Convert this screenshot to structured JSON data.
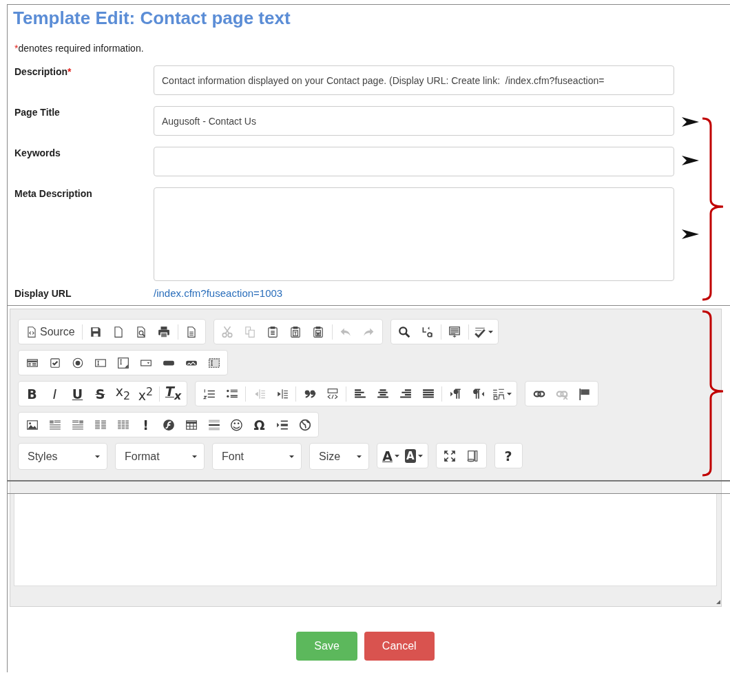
{
  "title": "Template Edit: Contact page text",
  "form": {
    "required_note": {
      "mark": "*",
      "text": "denotes required information."
    },
    "fields": [
      {
        "label": "Description",
        "required_mark": "*",
        "kind": "input",
        "value": "Contact information displayed on your Contact page. (Display URL: Create link:  /index.cfm?fuseaction="
      },
      {
        "label": "Page Title",
        "kind": "input",
        "value": "Augusoft - Contact Us"
      },
      {
        "label": "Keywords",
        "kind": "input"
      },
      {
        "label": "Meta Description",
        "kind": "textarea"
      }
    ],
    "display_url": {
      "label": "Display URL",
      "link": "/index.cfm?fuseaction=1003"
    }
  },
  "editor": {
    "toolbar": {
      "rows": [
        {
          "groups": [
            {
              "items": [
                {
                  "kind": "label-button",
                  "label": "Source",
                  "disabled": false
                },
                {
                  "kind": "separator"
                },
                {
                  "kind": "icon-button",
                  "disabled": false
                },
                {
                  "kind": "icon-button",
                  "disabled": false
                },
                {
                  "kind": "icon-button",
                  "disabled": false
                },
                {
                  "kind": "icon-button",
                  "disabled": false
                },
                {
                  "kind": "separator"
                },
                {
                  "kind": "icon-button",
                  "disabled": false
                }
              ]
            },
            {
              "items": [
                {
                  "kind": "icon-button",
                  "disabled": true
                },
                {
                  "kind": "icon-button",
                  "disabled": true
                },
                {
                  "kind": "icon-button",
                  "disabled": false
                },
                {
                  "kind": "icon-button",
                  "disabled": false
                },
                {
                  "kind": "icon-button",
                  "disabled": false
                },
                {
                  "kind": "separator"
                },
                {
                  "kind": "icon-button",
                  "disabled": true
                },
                {
                  "kind": "icon-button",
                  "disabled": true
                }
              ]
            },
            {
              "items": [
                {
                  "kind": "icon-button",
                  "disabled": false
                },
                {
                  "kind": "icon-button",
                  "disabled": false
                },
                {
                  "kind": "separator"
                },
                {
                  "kind": "icon-button",
                  "disabled": false
                },
                {
                  "kind": "separator"
                },
                {
                  "kind": "menu-button",
                  "disabled": false
                }
              ]
            }
          ]
        },
        {
          "groups": [
            {
              "items": [
                {
                  "kind": "icon-button",
                  "disabled": false
                },
                {
                  "kind": "icon-button",
                  "disabled": false
                },
                {
                  "kind": "icon-button",
                  "disabled": false
                },
                {
                  "kind": "icon-button",
                  "disabled": false
                },
                {
                  "kind": "icon-button",
                  "disabled": false
                },
                {
                  "kind": "icon-button",
                  "disabled": false
                },
                {
                  "kind": "icon-button",
                  "disabled": false
                },
                {
                  "kind": "icon-button",
                  "disabled": false
                },
                {
                  "kind": "icon-button",
                  "disabled": false
                }
              ]
            }
          ]
        },
        {
          "groups": [
            {
              "items": [
                {
                  "kind": "bold",
                  "label": "B",
                  "disabled": false
                },
                {
                  "kind": "italic",
                  "label": "I",
                  "disabled": false
                },
                {
                  "kind": "underline",
                  "label": "U",
                  "disabled": false
                },
                {
                  "kind": "strike",
                  "label": "S",
                  "disabled": false
                },
                {
                  "kind": "symbol",
                  "label": "x$_{2}$",
                  "disabled": false
                },
                {
                  "kind": "symbol",
                  "label": "x$^{2}$",
                  "disabled": false
                },
                {
                  "kind": "separator"
                },
                {
                  "kind": "clearformat",
                  "label": "T$_{x}$",
                  "disabled": false
                }
              ]
            },
            {
              "items": [
                {
                  "kind": "icon-button",
                  "disabled": false
                },
                {
                  "kind": "icon-button",
                  "disabled": false
                },
                {
                  "kind": "separator"
                },
                {
                  "kind": "icon-button",
                  "disabled": true
                },
                {
                  "kind": "icon-button",
                  "disabled": false
                },
                {
                  "kind": "separator"
                },
                {
                  "kind": "icon-button",
                  "disabled": false
                },
                {
                  "kind": "icon-button",
                  "disabled": false
                },
                {
                  "kind": "separator"
                },
                {
                  "kind": "icon-button",
                  "disabled": false
                },
                {
                  "kind": "icon-button",
                  "disabled": false
                },
                {
                  "kind": "icon-button",
                  "disabled": false
                },
                {
                  "kind": "icon-button",
                  "disabled": false
                },
                {
                  "kind": "separator"
                },
                {
                  "kind": "icon-button",
                  "disabled": false
                },
                {
                  "kind": "icon-button",
                  "disabled": false
                },
                {
                  "kind": "menu-button",
                  "disabled": false
                }
              ]
            },
            {
              "items": [
                {
                  "kind": "icon-button",
                  "disabled": false
                },
                {
                  "kind": "icon-button",
                  "disabled": true
                },
                {
                  "kind": "icon-button",
                  "disabled": false
                }
              ]
            }
          ]
        },
        {
          "groups": [
            {
              "items": [
                {
                  "kind": "icon-button",
                  "disabled": false
                },
                {
                  "kind": "icon-button",
                  "disabled": false
                },
                {
                  "kind": "icon-button",
                  "disabled": false
                },
                {
                  "kind": "icon-button",
                  "disabled": false
                },
                {
                  "kind": "icon-button",
                  "disabled": false
                },
                {
                  "kind": "mark",
                  "label": "!",
                  "disabled": false
                },
                {
                  "kind": "icon-button",
                  "disabled": false
                },
                {
                  "kind": "icon-button",
                  "disabled": false
                },
                {
                  "kind": "icon-button",
                  "disabled": false
                },
                {
                  "kind": "symbol",
                  "label": "☺",
                  "disabled": false
                },
                {
                  "kind": "mark",
                  "label": "Ω",
                  "disabled": false
                },
                {
                  "kind": "icon-button",
                  "disabled": false
                },
                {
                  "kind": "icon-button",
                  "disabled": false
                }
              ]
            }
          ]
        },
        {
          "groups": [
            {
              "items": [
                {
                  "kind": "combo",
                  "label": "Styles"
                }
              ]
            },
            {
              "items": [
                {
                  "kind": "combo",
                  "label": "Format"
                }
              ]
            },
            {
              "items": [
                {
                  "kind": "combo",
                  "label": "Font"
                }
              ]
            },
            {
              "items": [
                {
                  "kind": "combo",
                  "label": "Size"
                }
              ]
            },
            {
              "items": [
                {
                  "kind": "fontcolor",
                  "label": "A",
                  "disabled": false
                },
                {
                  "kind": "highlight",
                  "label": "A",
                  "disabled": false
                }
              ]
            },
            {
              "items": [
                {
                  "kind": "icon-button",
                  "disabled": false
                },
                {
                  "kind": "icon-button",
                  "disabled": false
                }
              ]
            },
            {
              "items": [
                {
                  "kind": "mark",
                  "label": "?",
                  "disabled": false
                }
              ]
            }
          ]
        }
      ]
    }
  },
  "buttons": [
    {
      "label": "Save",
      "kind": "save"
    },
    {
      "label": "Cancel",
      "kind": "cancel"
    }
  ]
}
